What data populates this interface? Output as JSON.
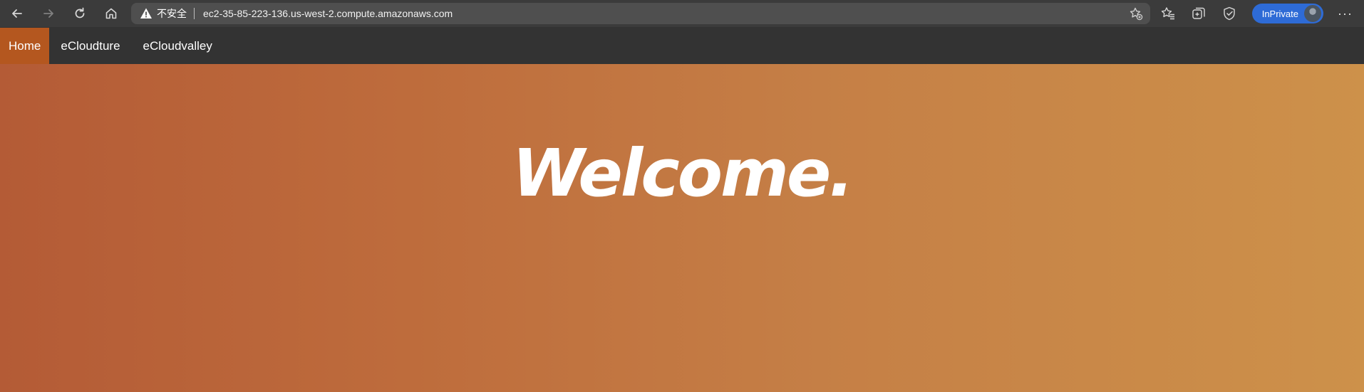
{
  "browser": {
    "insecure_label": "不安全",
    "url": "ec2-35-85-223-136.us-west-2.compute.amazonaws.com",
    "inprivate_label": "InPrivate",
    "more_label": "···",
    "icons": {
      "back": "back-arrow-icon",
      "forward": "forward-arrow-icon",
      "refresh": "refresh-icon",
      "home": "home-icon",
      "warning": "warning-icon",
      "add_favorite": "add-favorite-icon",
      "favorites": "favorites-icon",
      "collections": "collections-icon",
      "browser_essentials": "browser-essentials-icon",
      "avatar": "avatar"
    }
  },
  "site_nav": {
    "items": [
      {
        "label": "Home",
        "active": true
      },
      {
        "label": "eCloudture",
        "active": false
      },
      {
        "label": "eCloudvalley",
        "active": false
      }
    ]
  },
  "hero": {
    "title": "Welcome."
  },
  "colors": {
    "nav_bg": "#333333",
    "nav_active": "#b4571f",
    "hero_gradient_start": "#b45b36",
    "hero_gradient_end": "#cd914a",
    "inprivate_bg": "#2e6bd6"
  }
}
